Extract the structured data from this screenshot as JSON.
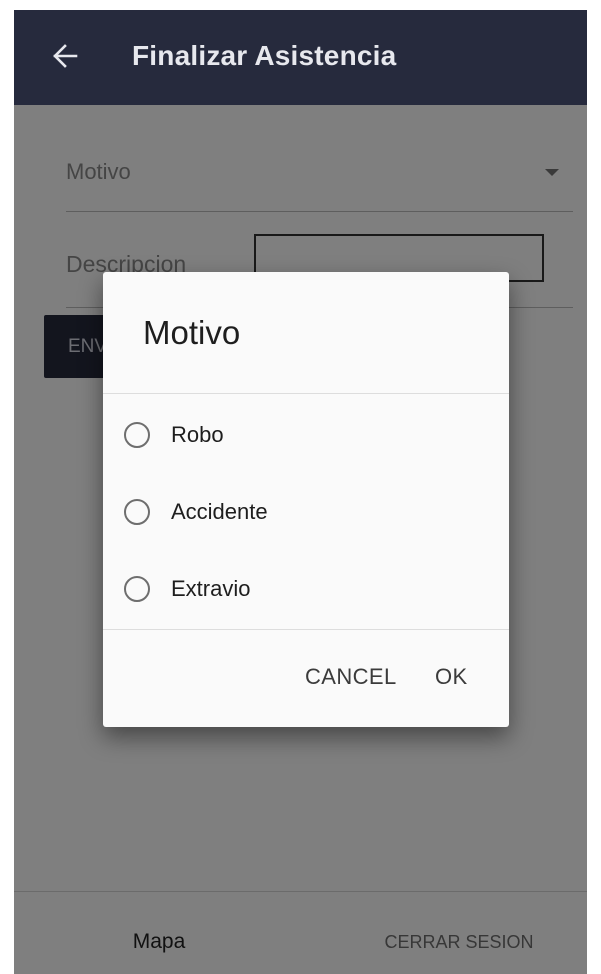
{
  "app_bar": {
    "title": "Finalizar Asistencia",
    "back_icon": "arrow-back-icon",
    "background": "#262a3d"
  },
  "form": {
    "motivo_select": {
      "label": "Motivo",
      "icon": "dropdown-arrow-icon"
    },
    "descripcion": {
      "label": "Descripcion",
      "value": ""
    },
    "submit_label": "ENVIAR"
  },
  "bottom_nav": {
    "items": [
      {
        "label": "Mapa"
      },
      {
        "label": "CERRAR SESION"
      }
    ]
  },
  "dialog": {
    "title": "Motivo",
    "options": [
      {
        "label": "Robo",
        "selected": false
      },
      {
        "label": "Accidente",
        "selected": false
      },
      {
        "label": "Extravio",
        "selected": false
      }
    ],
    "cancel_label": "CANCEL",
    "ok_label": "OK"
  },
  "colors": {
    "primary": "#262a3d",
    "scrim": "rgba(0,0,0,0.5)",
    "dialog_background": "#fafafa"
  }
}
